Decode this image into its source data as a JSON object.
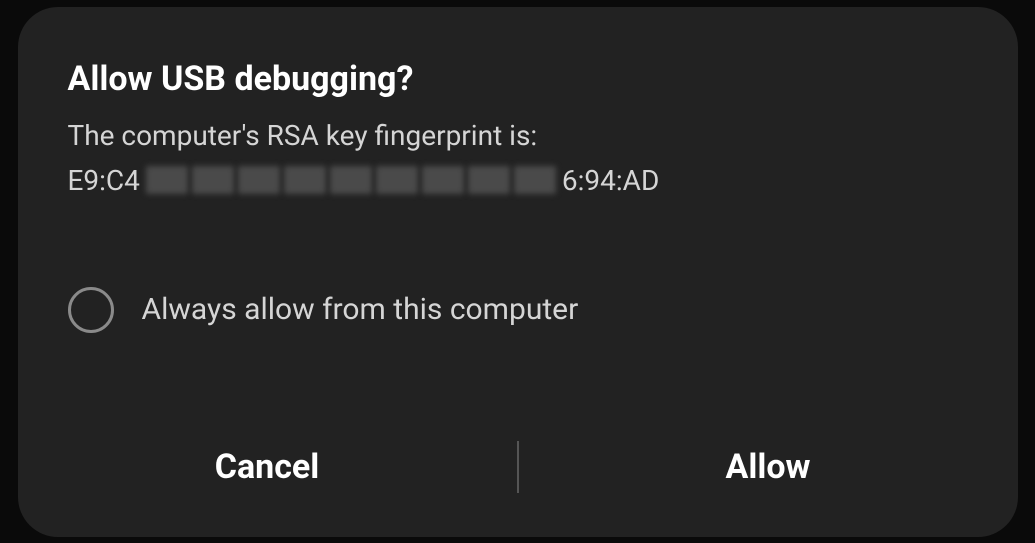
{
  "dialog": {
    "title": "Allow USB debugging?",
    "subtitle": "The computer's RSA key fingerprint is:",
    "fingerprint_start": "E9:C4",
    "fingerprint_end": "6:94:AD",
    "checkbox_label": "Always allow from this computer",
    "cancel_label": "Cancel",
    "allow_label": "Allow"
  }
}
